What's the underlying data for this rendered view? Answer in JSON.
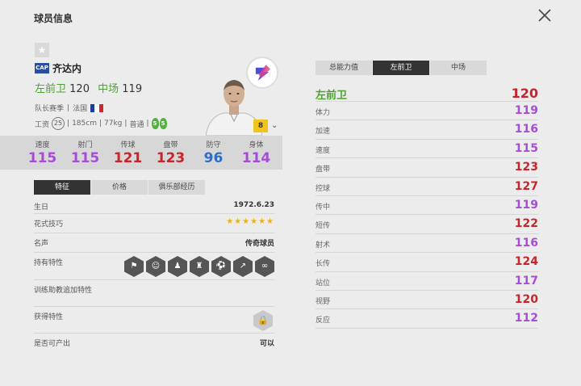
{
  "header": {
    "title": "球员信息"
  },
  "player": {
    "name": "齐达内",
    "cap_label": "CAP",
    "pos1": "左前卫",
    "val1": "120",
    "pos2": "中场",
    "val2": "119",
    "season": "队长赛季",
    "sep1": "|",
    "country": "法国",
    "salary_label": "工资",
    "salary": "25",
    "height": "185cm",
    "weight": "77kg",
    "body": "普通",
    "foot_left": "5",
    "foot_right": "5",
    "level": "8"
  },
  "stats": [
    {
      "label": "速度",
      "value": "115",
      "color": "#a64dd8"
    },
    {
      "label": "射门",
      "value": "115",
      "color": "#a64dd8"
    },
    {
      "label": "传球",
      "value": "121",
      "color": "#c8242a"
    },
    {
      "label": "盘带",
      "value": "123",
      "color": "#c8242a"
    },
    {
      "label": "防守",
      "value": "96",
      "color": "#2e6cc6"
    },
    {
      "label": "身体",
      "value": "114",
      "color": "#a64dd8"
    }
  ],
  "left_tabs": [
    "特征",
    "价格",
    "俱乐部经历"
  ],
  "info": {
    "birth_label": "生日",
    "birth": "1972.6.23",
    "skill_label": "花式技巧",
    "skill_stars": "★★★★★★",
    "rep_label": "名声",
    "rep": "传奇球员",
    "traits_label": "持有特性",
    "train_label": "训练助教追加特性",
    "gain_label": "获得特性",
    "produce_label": "是否可产出",
    "produce": "可以"
  },
  "right_tabs": [
    "总能力值",
    "左前卫",
    "中场"
  ],
  "attributes": [
    {
      "label": "左前卫",
      "value": "120",
      "color": "#c8242a"
    },
    {
      "label": "体力",
      "value": "119",
      "color": "#a64dd8"
    },
    {
      "label": "加速",
      "value": "116",
      "color": "#a64dd8"
    },
    {
      "label": "速度",
      "value": "115",
      "color": "#a64dd8"
    },
    {
      "label": "盘带",
      "value": "123",
      "color": "#c8242a"
    },
    {
      "label": "控球",
      "value": "127",
      "color": "#c8242a"
    },
    {
      "label": "传中",
      "value": "119",
      "color": "#a64dd8"
    },
    {
      "label": "短传",
      "value": "122",
      "color": "#c8242a"
    },
    {
      "label": "射术",
      "value": "116",
      "color": "#a64dd8"
    },
    {
      "label": "长传",
      "value": "124",
      "color": "#c8242a"
    },
    {
      "label": "站位",
      "value": "117",
      "color": "#a64dd8"
    },
    {
      "label": "视野",
      "value": "120",
      "color": "#c8242a"
    },
    {
      "label": "反应",
      "value": "112",
      "color": "#a64dd8"
    }
  ]
}
